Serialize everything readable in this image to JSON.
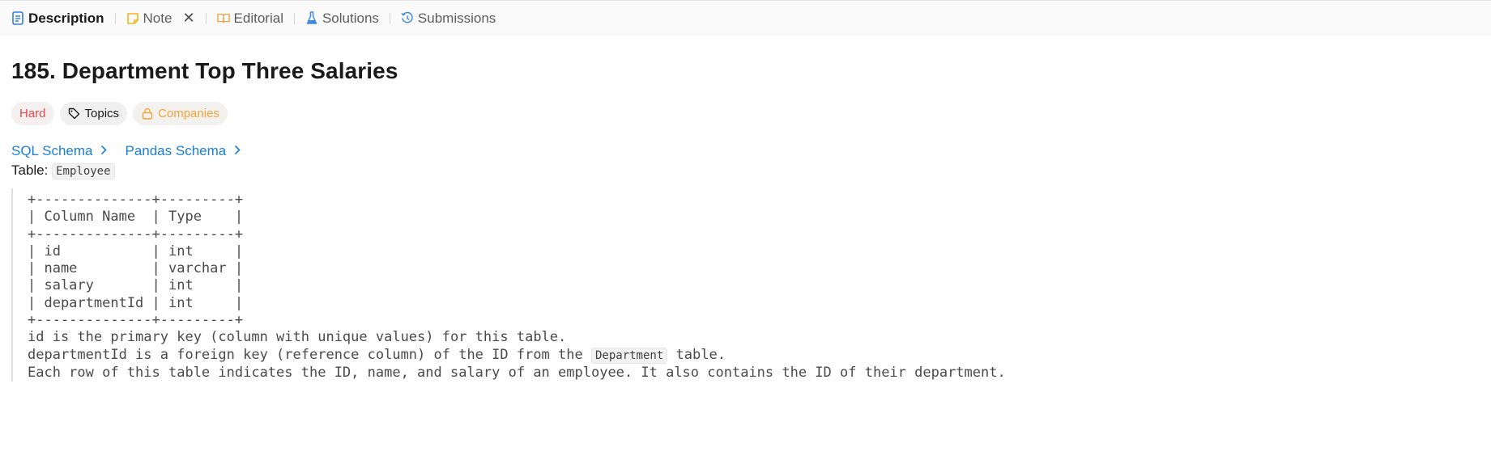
{
  "tabs": [
    {
      "label": "Description",
      "icon": "description-icon",
      "active": true
    },
    {
      "label": "Note",
      "icon": "note-icon",
      "closable": true
    },
    {
      "label": "Editorial",
      "icon": "book-icon"
    },
    {
      "label": "Solutions",
      "icon": "flask-icon"
    },
    {
      "label": "Submissions",
      "icon": "history-icon"
    }
  ],
  "problem": {
    "title": "185. Department Top Three Salaries",
    "difficulty": "Hard",
    "topics_label": "Topics",
    "companies_label": "Companies"
  },
  "schema_links": {
    "sql": "SQL Schema",
    "pandas": "Pandas Schema"
  },
  "table": {
    "prefix": "Table:",
    "name": "Employee"
  },
  "schema_block": {
    "border": "+--------------+---------+",
    "header": "| Column Name  | Type    |",
    "rows": [
      "| id           | int     |",
      "| name         | varchar |",
      "| salary       | int     |",
      "| departmentId | int     |"
    ],
    "note1": "id is the primary key (column with unique values) for this table.",
    "note2_before": "departmentId is a foreign key (reference column) of the ID from the ",
    "note2_code": "Department",
    "note2_after": " table.",
    "note3": "Each row of this table indicates the ID, name, and salary of an employee. It also contains the ID of their department."
  },
  "colors": {
    "accent_blue": "#1a7fd4",
    "hard_red": "#e5484d",
    "companies_orange": "#f2a33a",
    "note_yellow": "#f5b31b",
    "editorial_orange": "#f2a33a",
    "solutions_blue": "#3c8be0",
    "submissions_blue": "#3c8be0"
  }
}
